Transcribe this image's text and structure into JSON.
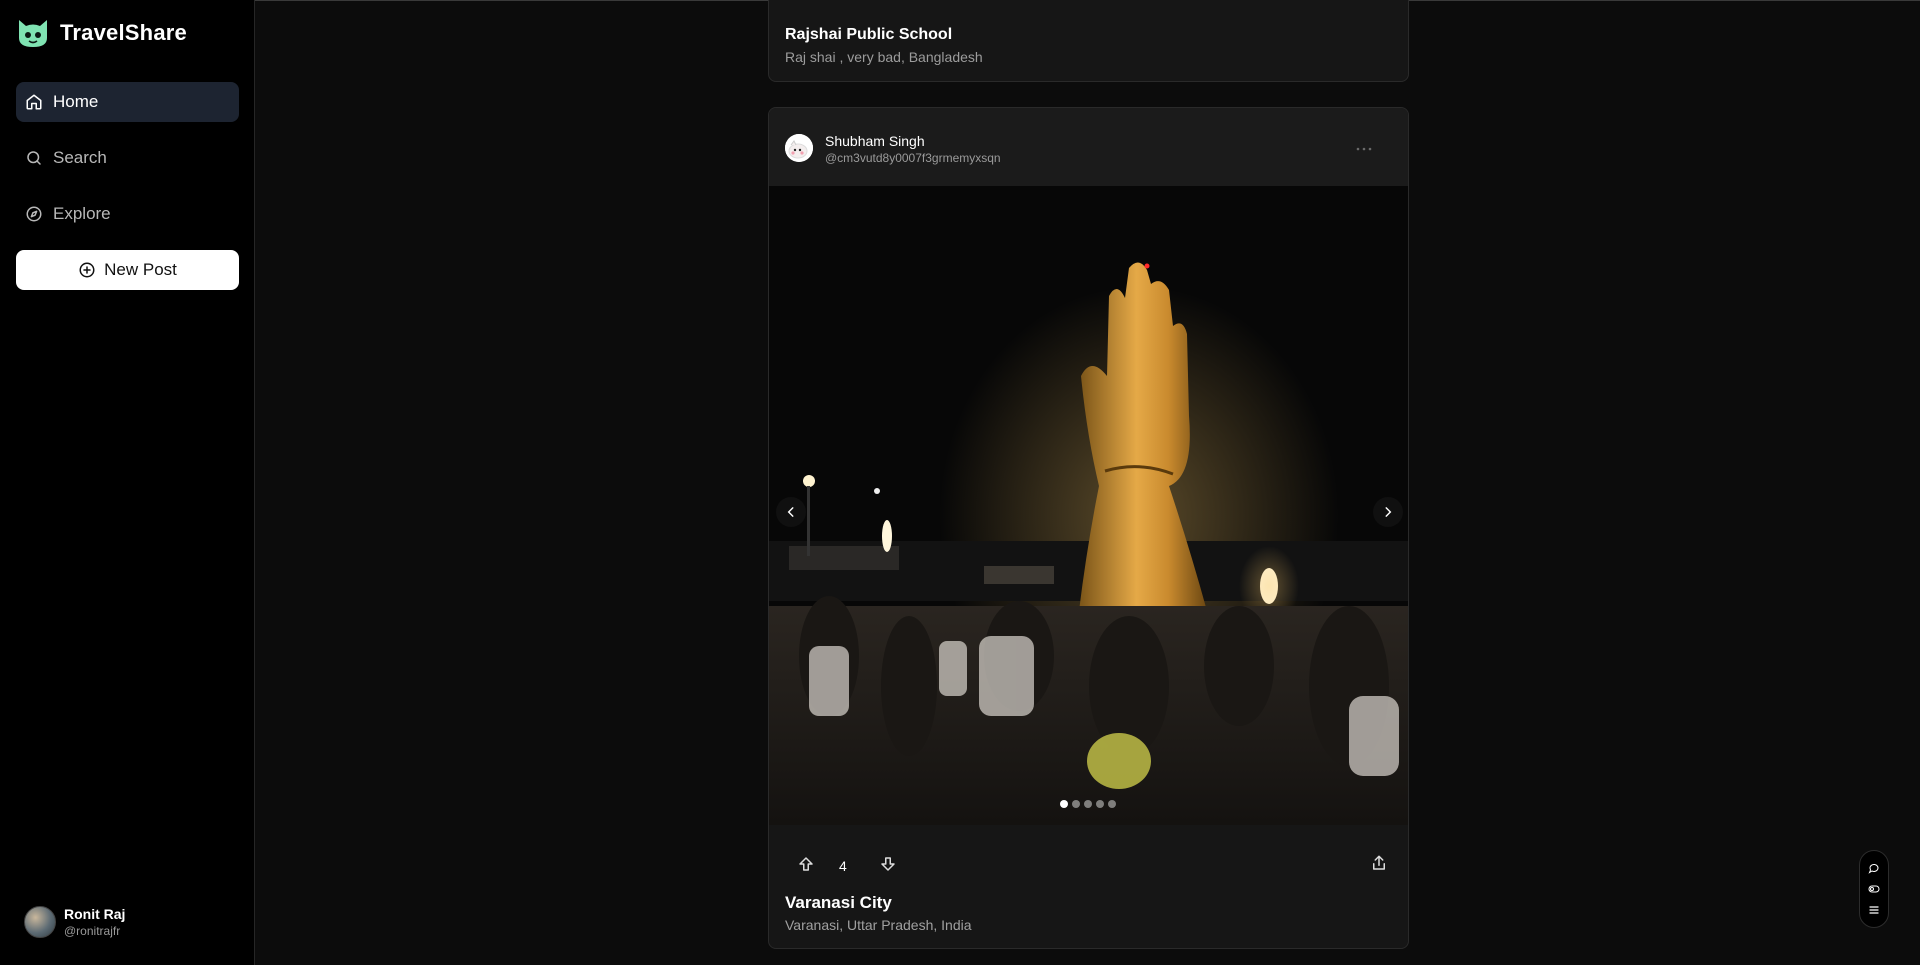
{
  "app": {
    "name": "TravelShare"
  },
  "sidebar": {
    "nav": [
      {
        "label": "Home",
        "icon": "home-icon",
        "active": true
      },
      {
        "label": "Search",
        "icon": "search-icon",
        "active": false
      },
      {
        "label": "Explore",
        "icon": "compass-icon",
        "active": false
      }
    ],
    "new_post_label": "New Post",
    "user": {
      "name": "Ronit Raj",
      "handle": "@ronitrajfr"
    }
  },
  "feed": {
    "previous_post": {
      "title": "Rajshai Public School",
      "location": "Raj shai , very bad, Bangladesh"
    },
    "post": {
      "author": "Shubham Singh",
      "handle": "@cm3vutd8y0007f3grmemyxsqn",
      "image_count": 5,
      "active_image": 1,
      "votes": "4",
      "title": "Varanasi City",
      "location": "Varanasi, Uttar Pradesh, India"
    }
  },
  "colors": {
    "accent_active": "#1d2431",
    "logo_green": "#7fe3b2",
    "background": "#0c0c0c"
  }
}
